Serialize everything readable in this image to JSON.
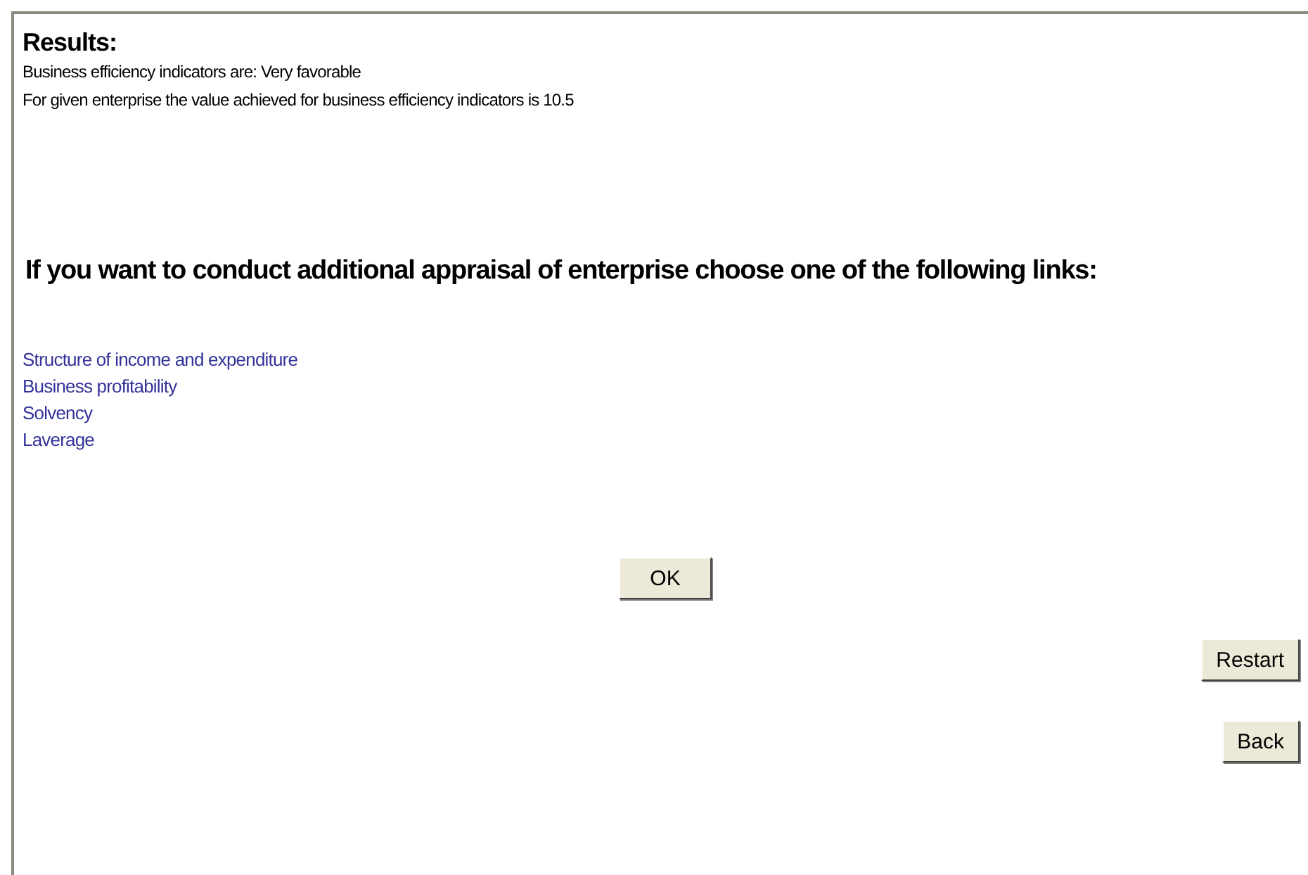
{
  "results": {
    "title": "Results:",
    "lines": [
      "Business efficiency indicators are: Very favorable",
      "For given enterprise the value achieved for business efficiency indicators is 10.5"
    ]
  },
  "prompt": "If you want to conduct additional appraisal of enterprise choose one of the following links:",
  "links": [
    "Structure of income and expenditure",
    "Business profitability",
    "Solvency",
    "Laverage"
  ],
  "ok_button": "OK",
  "side_buttons": [
    "Restart",
    "Back"
  ]
}
